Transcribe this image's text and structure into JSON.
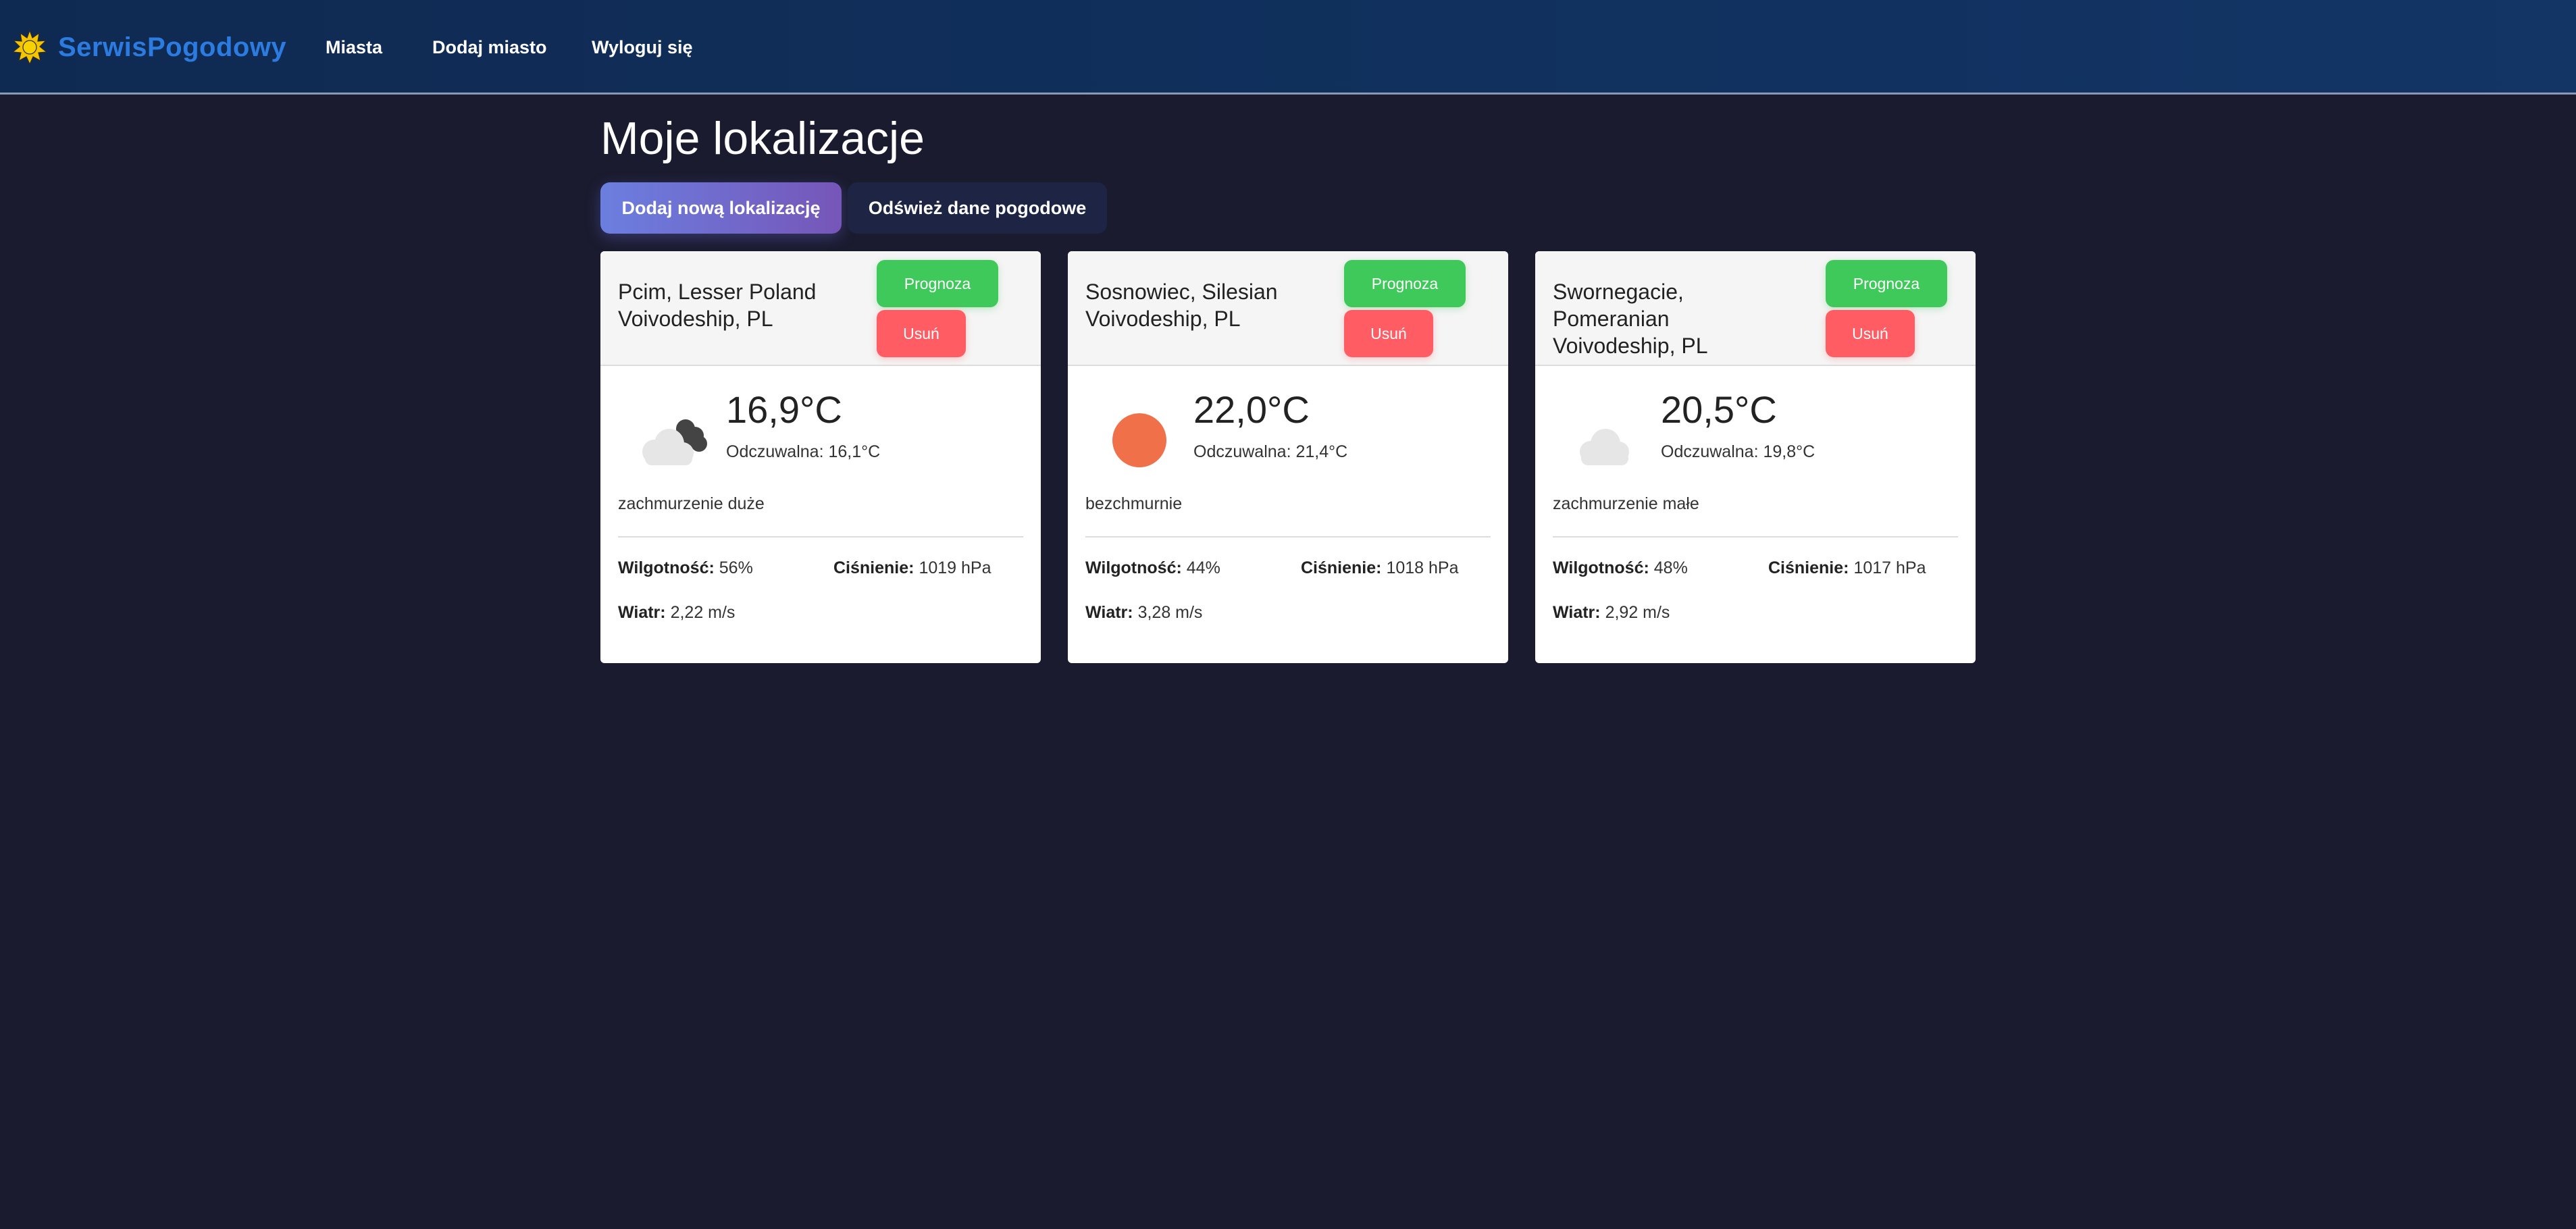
{
  "nav": {
    "brand": "SerwisPogodowy",
    "links": [
      "Miasta",
      "Dodaj miasto",
      "Wyloguj się"
    ]
  },
  "page": {
    "title": "Moje lokalizacje",
    "add_button": "Dodaj nową lokalizację",
    "refresh_button": "Odśwież dane pogodowe"
  },
  "labels": {
    "forecast": "Prognoza",
    "delete": "Usuń",
    "humidity": "Wilgotność:",
    "pressure": "Ciśnienie:",
    "wind": "Wiatr:"
  },
  "cards": [
    {
      "city": "Pcim, Lesser Poland Voivodeship, PL",
      "icon": "cloudy-overcast-icon",
      "temp": "16,9°C",
      "feels_like": "Odczuwalna: 16,1°C",
      "description": "zachmurzenie duże",
      "humidity": "56%",
      "pressure": "1019 hPa",
      "wind": "2,22 m/s"
    },
    {
      "city": "Sosnowiec, Silesian Voivodeship, PL",
      "icon": "sun-icon",
      "temp": "22,0°C",
      "feels_like": "Odczuwalna: 21,4°C",
      "description": "bezchmurnie",
      "humidity": "44%",
      "pressure": "1018 hPa",
      "wind": "3,28 m/s"
    },
    {
      "city": "Swornegacie, Pomeranian Voivodeship, PL",
      "icon": "cloud-icon",
      "temp": "20,5°C",
      "feels_like": "Odczuwalna: 19,8°C",
      "description": "zachmurzenie małe",
      "humidity": "48%",
      "pressure": "1017 hPa",
      "wind": "2,92 m/s"
    }
  ],
  "colors": {
    "background": "#1a1b2e",
    "navbar": "#0f2a52",
    "brand": "#2b7be0",
    "forecast_button": "#3fc95a",
    "delete_button": "#ff5c63",
    "sun": "#f0704a"
  }
}
